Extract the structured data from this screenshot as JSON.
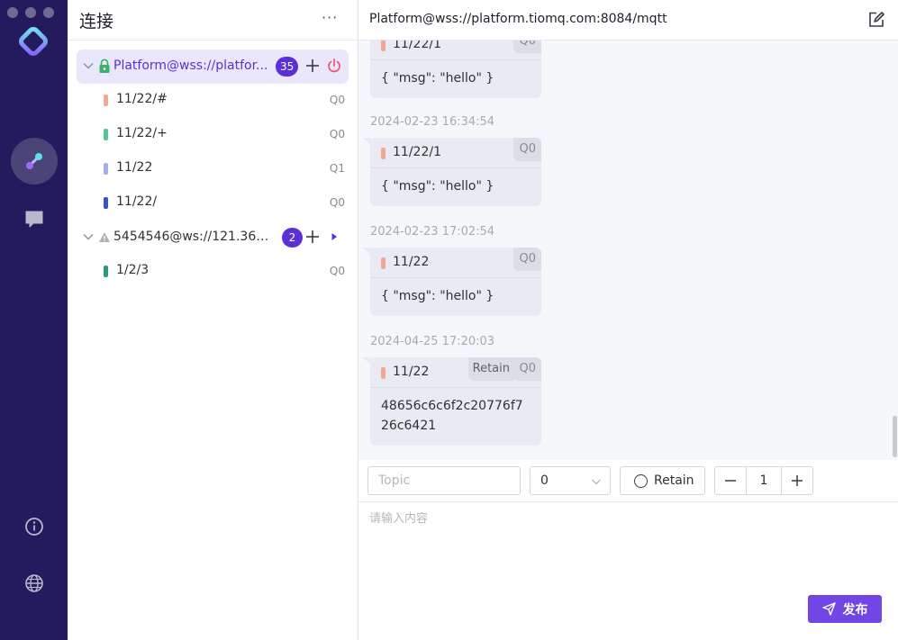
{
  "window": {
    "controls": [
      "close",
      "minimize",
      "maximize"
    ]
  },
  "sidebar": {
    "nav": [
      "logo-icon",
      "connections-icon",
      "chat-icon",
      "info-icon",
      "globe-icon"
    ],
    "colors": {
      "background": "#231b5e",
      "active": "#4a4477"
    }
  },
  "connections_panel": {
    "title": "连接",
    "more_label": "···",
    "connections": [
      {
        "name": "Platform@wss://platfor...",
        "status_icon": "lock-icon",
        "badge": "35",
        "action_icon": "power-icon",
        "active": true,
        "subscriptions": [
          {
            "topic": "11/22/#",
            "qos": "Q0",
            "color": "#f0a893"
          },
          {
            "topic": "11/22/+",
            "qos": "Q0",
            "color": "#52c893"
          },
          {
            "topic": "11/22",
            "qos": "Q1",
            "color": "#a3aef0"
          },
          {
            "topic": "11/22/",
            "qos": "Q0",
            "color": "#3a4fd6"
          }
        ]
      },
      {
        "name": "5454546@ws://121.36.14...",
        "status_icon": "warning-icon",
        "badge": "2",
        "action_icon": "play-icon",
        "active": false,
        "subscriptions": [
          {
            "topic": "1/2/3",
            "qos": "Q0",
            "color": "#2a9a7a"
          }
        ]
      }
    ]
  },
  "main": {
    "title": "Platform@wss://platform.tiomq.com:8084/mqtt",
    "messages": [
      {
        "time": "",
        "topic": "11/22/1",
        "qos": "Q0",
        "retain": "",
        "payload": "{ \"msg\": \"hello\" }"
      },
      {
        "time": "2024-02-23 16:34:54",
        "topic": "11/22/1",
        "qos": "Q0",
        "retain": "",
        "payload": "{ \"msg\": \"hello\" }"
      },
      {
        "time": "2024-02-23 17:02:54",
        "topic": "11/22",
        "qos": "Q0",
        "retain": "",
        "payload": "{ \"msg\": \"hello\" }"
      },
      {
        "time": "2024-04-25 17:20:03",
        "topic": "11/22",
        "qos": "Q0",
        "retain": "Retain",
        "payload": "48656c6c6f2c20776f726c6421"
      }
    ]
  },
  "publish": {
    "topic_placeholder": "Topic",
    "qos_value": "0",
    "retain_label": "Retain",
    "stepper_value": "1",
    "payload_placeholder": "请输入内容",
    "send_label": "发布",
    "accent": "#7146e4"
  }
}
